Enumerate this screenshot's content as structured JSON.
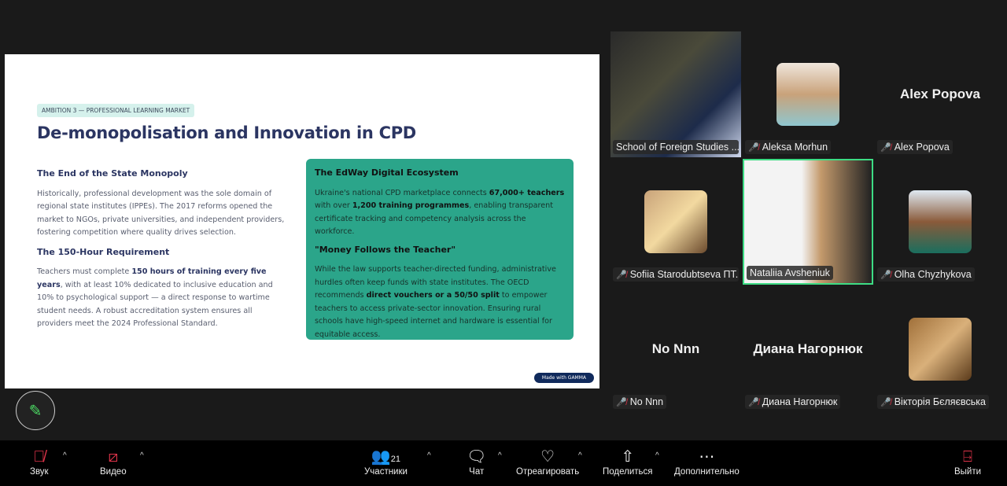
{
  "slide": {
    "badge": "AMBITION 3 — PROFESSIONAL LEARNING MARKET",
    "title": "De-monopolisation and Innovation in CPD",
    "left": {
      "h1": "The End of the State Monopoly",
      "p1": "Historically, professional development was the sole domain of regional state institutes (IPPEs). The 2017 reforms opened the market to NGOs, private universities, and independent providers, fostering competition where quality drives selection.",
      "h2": "The 150-Hour Requirement",
      "p2a": "Teachers must complete ",
      "p2b": "150 hours of training every five years",
      "p2c": ", with at least 10% dedicated to inclusive education and 10% to psychological support — a direct response to wartime student needs. A robust accreditation system ensures all providers meet the 2024 Professional Standard."
    },
    "card": {
      "h1": "The EdWay Digital Ecosystem",
      "p1a": "Ukraine's national CPD marketplace connects ",
      "p1b": "67,000+ teachers",
      "p1c": " with over ",
      "p1d": "1,200 training programmes",
      "p1e": ", enabling transparent certificate tracking and competency analysis across the workforce.",
      "h2": "\"Money Follows the Teacher\"",
      "p2a": "While the law supports teacher-directed funding, administrative hurdles often keep funds with state institutes. The OECD recommends ",
      "p2b": "direct vouchers or a 50/50 split",
      "p2c": " to empower teachers to access private-sector innovation. Ensuring rural schools have high-speed internet and hardware is essential for equitable access."
    },
    "made_with": "Made with GAMMA"
  },
  "participants": [
    {
      "name": "School of Foreign Studies ...",
      "muted": false
    },
    {
      "name": "Aleksa Morhun",
      "muted": true
    },
    {
      "name": "Alex Popova",
      "muted": true,
      "big": "Alex Popova"
    },
    {
      "name": "Sofiia Starodubtseva ПТ...",
      "muted": true
    },
    {
      "name": "Nataliia Avsheniuk",
      "muted": false,
      "active": true
    },
    {
      "name": "Olha Chyzhykova",
      "muted": true
    },
    {
      "name": "No Nnn",
      "muted": true,
      "big": "No Nnn"
    },
    {
      "name": "Диана Нагорнюк",
      "muted": true,
      "big": "Диана Нагорнюк"
    },
    {
      "name": "Вікторія Бєляєвська",
      "muted": true
    }
  ],
  "toolbar": {
    "audio": "Звук",
    "video": "Видео",
    "participants": "Участники",
    "participants_count": "21",
    "chat": "Чат",
    "react": "Отреагировать",
    "share": "Поделиться",
    "more": "Дополнительно",
    "leave": "Выйти"
  },
  "colors": {
    "accent": "#2ba58a",
    "active_border": "#3ddc84",
    "muted": "#e0344a"
  }
}
